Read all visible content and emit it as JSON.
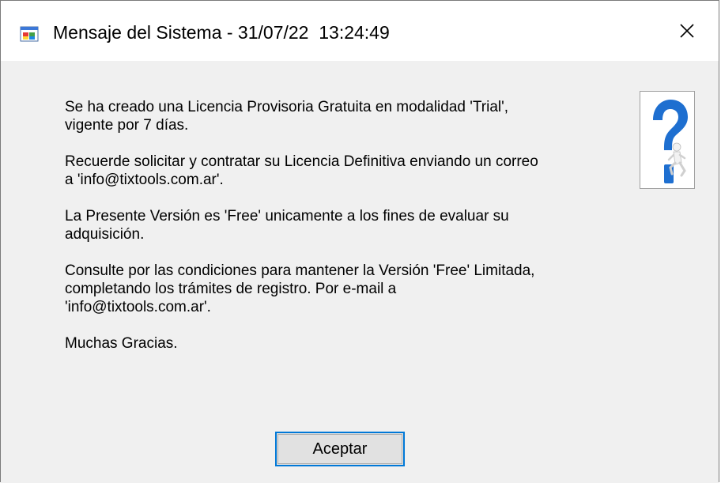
{
  "window": {
    "title": "Mensaje del Sistema - 31/07/22  13:24:49",
    "icon": "windows-app-icon",
    "close_icon": "close-icon"
  },
  "message": {
    "paragraphs": [
      "Se ha creado una Licencia Provisoria Gratuita en modalidad 'Trial',\nvigente por 7 días.",
      "Recuerde solicitar y contratar su Licencia Definitiva enviando un correo\na 'info@tixtools.com.ar'.",
      "La Presente Versión es 'Free' unicamente a los fines de evaluar su\nadquisición.",
      "Consulte por las condiciones para mantener la Versión 'Free' Limitada,\ncompletando los trámites de registro. Por e-mail a\n'info@tixtools.com.ar'.",
      "Muchas Gracias."
    ],
    "image": "question-mark-figure-icon"
  },
  "buttons": {
    "accept_label": "Aceptar"
  },
  "colors": {
    "accent": "#0078d7",
    "client_bg": "#f0f0f0",
    "question_blue": "#1e6fd0"
  }
}
